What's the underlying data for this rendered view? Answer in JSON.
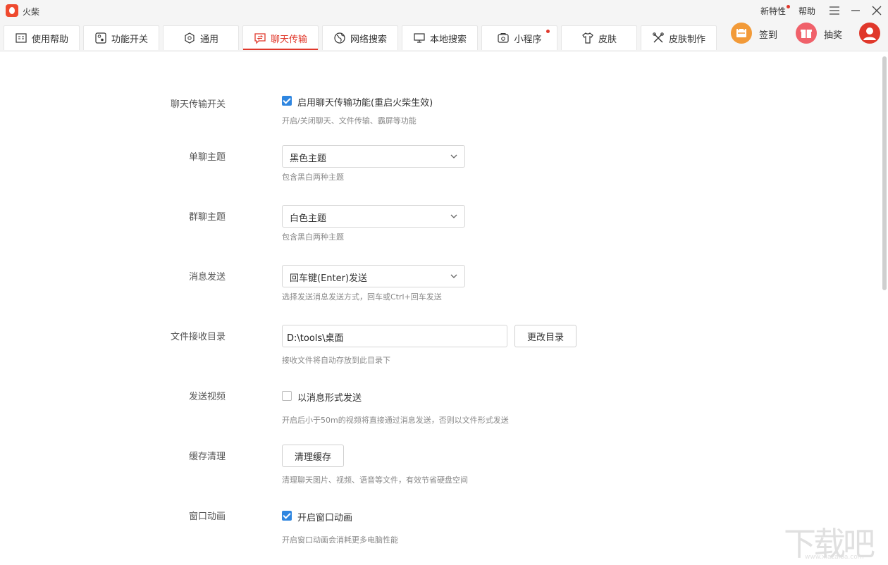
{
  "app": {
    "title": "火柴"
  },
  "topbar": {
    "new_features": "新特性",
    "help": "帮助"
  },
  "tabs": [
    {
      "label": "使用帮助"
    },
    {
      "label": "功能开关"
    },
    {
      "label": "通用"
    },
    {
      "label": "聊天传输"
    },
    {
      "label": "网络搜索"
    },
    {
      "label": "本地搜索"
    },
    {
      "label": "小程序"
    },
    {
      "label": "皮肤"
    },
    {
      "label": "皮肤制作"
    }
  ],
  "actions": {
    "signin": "签到",
    "lottery": "抽奖"
  },
  "colors": {
    "accent": "#e0382b",
    "checkbox": "#2f86e0",
    "signin": "#f29a38",
    "lottery": "#f0616a"
  },
  "settings": {
    "chat_switch": {
      "label": "聊天传输开关",
      "checkbox": "启用聊天传输功能(重启火柴生效)",
      "checked": true,
      "hint": "开启/关闭聊天、文件传输、霸屏等功能"
    },
    "single_theme": {
      "label": "单聊主题",
      "value": "黑色主题",
      "hint": "包含黑白两种主题"
    },
    "group_theme": {
      "label": "群聊主题",
      "value": "白色主题",
      "hint": "包含黑白两种主题"
    },
    "send_msg": {
      "label": "消息发送",
      "value": "回车键(Enter)发送",
      "hint": "选择发送消息发送方式，回车或Ctrl+回车发送"
    },
    "recv_dir": {
      "label": "文件接收目录",
      "value": "D:\\tools\\桌面",
      "button": "更改目录",
      "hint": "接收文件将自动存放到此目录下"
    },
    "send_video": {
      "label": "发送视频",
      "checkbox": "以消息形式发送",
      "checked": false,
      "hint": "开启后小于50m的视频将直接通过消息发送，否则以文件形式发送"
    },
    "cache_clean": {
      "label": "缓存清理",
      "button": "清理缓存",
      "hint": "清理聊天图片、视频、语音等文件，有效节省硬盘空间"
    },
    "window_anim": {
      "label": "窗口动画",
      "checkbox": "开启窗口动画",
      "checked": true,
      "hint": "开启窗口动画会消耗更多电脑性能"
    }
  },
  "watermark": {
    "text": "下载吧",
    "url": "www.xiazaiba.com"
  }
}
